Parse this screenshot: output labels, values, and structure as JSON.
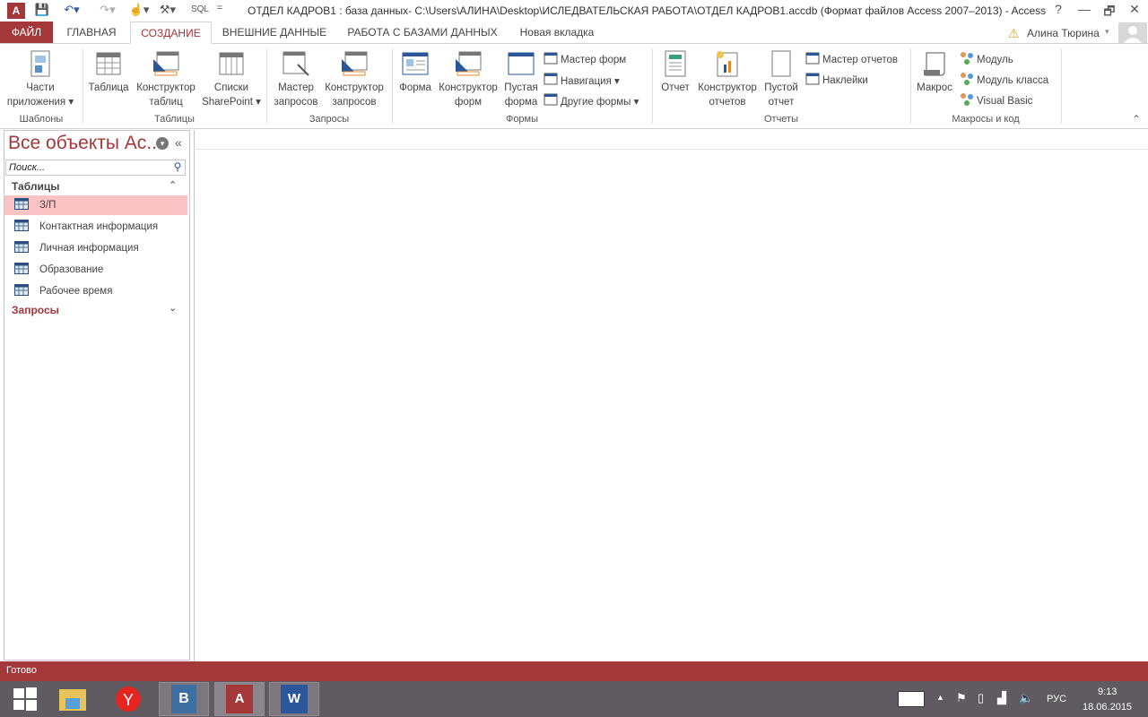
{
  "window": {
    "title": "ОТДЕЛ КАДРОВ1 : база данных- C:\\Users\\АЛИНА\\Desktop\\ИСЛЕДВАТЕЛЬСКАЯ РАБОТА\\ОТДЕЛ КАДРОВ1.accdb (Формат файлов Access 2007–2013) - Access",
    "help": "?",
    "minimize": "—",
    "restore": "🗗",
    "close": "✕"
  },
  "qat": {
    "sql": "SQL",
    "more": "="
  },
  "tabs": [
    "ФАЙЛ",
    "ГЛАВНАЯ",
    "СОЗДАНИЕ",
    "ВНЕШНИЕ ДАННЫЕ",
    "РАБОТА С БАЗАМИ ДАННЫХ",
    "Новая вкладка"
  ],
  "user": {
    "name": "Алина Тюрина"
  },
  "ribbon": {
    "groups": [
      "Шаблоны",
      "Таблицы",
      "Запросы",
      "Формы",
      "Отчеты",
      "Макросы и код"
    ],
    "big": [
      {
        "l1": "Части",
        "l2": "приложения ▾"
      },
      {
        "l1": "Таблица",
        "l2": ""
      },
      {
        "l1": "Конструктор",
        "l2": "таблиц"
      },
      {
        "l1": "Списки",
        "l2": "SharePoint ▾"
      },
      {
        "l1": "Мастер",
        "l2": "запросов"
      },
      {
        "l1": "Конструктор",
        "l2": "запросов"
      },
      {
        "l1": "Форма",
        "l2": ""
      },
      {
        "l1": "Конструктор",
        "l2": "форм"
      },
      {
        "l1": "Пустая",
        "l2": "форма"
      },
      {
        "l1": "Отчет",
        "l2": ""
      },
      {
        "l1": "Конструктор",
        "l2": "отчетов"
      },
      {
        "l1": "Пустой",
        "l2": "отчет"
      },
      {
        "l1": "Макрос",
        "l2": ""
      }
    ],
    "small": [
      "Мастер форм",
      "Навигация ▾",
      "Другие формы ▾",
      "Мастер отчетов",
      "Наклейки",
      "Модуль",
      "Модуль класса",
      "Visual Basic"
    ],
    "collapse": "⌃"
  },
  "nav": {
    "title": "Все объекты Ac...",
    "search_placeholder": "Поиск...",
    "tables_header": "Таблицы",
    "tables": [
      "З/П",
      "Контактная информация",
      "Личная информация",
      "Образование",
      "Рабочее время"
    ],
    "queries_header": "Запросы",
    "collapse": "«",
    "up": "⌃",
    "down": "⌄"
  },
  "status": {
    "text": "Готово"
  },
  "taskbar": {
    "vk": "B",
    "lang": "РУС",
    "time": "9:13",
    "date": "18.06.2015"
  },
  "colors": {
    "accent": "#a4373a",
    "selected": "#fcc3c4"
  }
}
